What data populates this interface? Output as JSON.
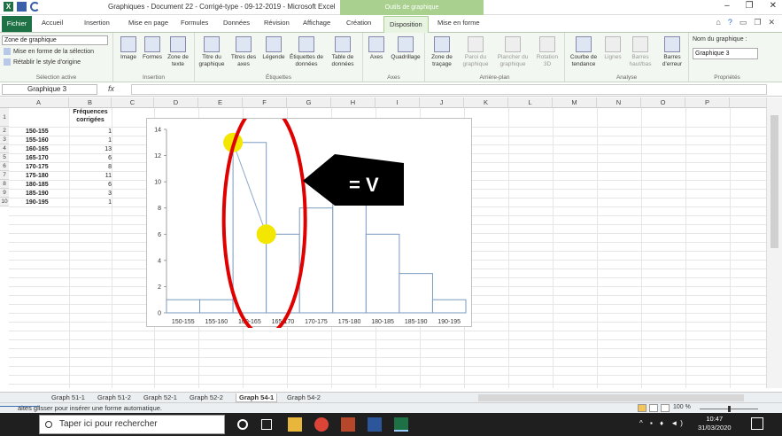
{
  "titlebar": {
    "doc_title": "Graphiques - Document 22 - Corrigé-type - 09-12-2019 - Microsoft Excel",
    "ctx_group": "Outils de graphique"
  },
  "tabs": {
    "file": "Fichier",
    "home": "Accueil",
    "insert": "Insertion",
    "page_layout": "Mise en page",
    "formulas": "Formules",
    "data": "Données",
    "review": "Révision",
    "view": "Affichage",
    "design": "Création",
    "layout": "Disposition",
    "format": "Mise en forme"
  },
  "ribbon": {
    "selection_combo": "Zone de graphique",
    "format_selection": "Mise en forme de la sélection",
    "reset_style": "Rétablir le style d'origine",
    "group_selection": "Sélection active",
    "image": "Image",
    "shapes": "Formes",
    "textbox": "Zone de texte",
    "group_insert": "Insertion",
    "chart_title": "Titre du graphique",
    "axis_titles": "Titres des axes",
    "legend": "Légende",
    "data_labels": "Étiquettes de données",
    "data_table": "Table de données",
    "group_labels": "Étiquettes",
    "axes": "Axes",
    "gridlines": "Quadrillage",
    "group_axes": "Axes",
    "plot_area": "Zone de traçage",
    "chart_wall": "Paroi du graphique",
    "chart_floor": "Plancher du graphique",
    "rotation": "Rotation 3D",
    "group_background": "Arrière-plan",
    "trendline": "Courbe de tendance",
    "lines": "Lignes",
    "updown_bars": "Barres haut/bas",
    "error_bars": "Barres d'erreur",
    "group_analysis": "Analyse",
    "chart_name_label": "Nom du graphique :",
    "chart_name_value": "Graphique 3",
    "group_properties": "Propriétés"
  },
  "formula_bar": {
    "name_box": "Graphique 3",
    "fx": "fx"
  },
  "columns": [
    "A",
    "B",
    "C",
    "D",
    "E",
    "F",
    "G",
    "H",
    "I",
    "J",
    "K",
    "L",
    "M",
    "N",
    "O",
    "P"
  ],
  "rows": [
    "1",
    "2",
    "3",
    "4",
    "5",
    "6",
    "7",
    "8",
    "9",
    "10"
  ],
  "sheet": {
    "header_b_line1": "Fréquences",
    "header_b_line2": "corrigées",
    "data": [
      {
        "label": "150-155",
        "value": "1"
      },
      {
        "label": "155-160",
        "value": "1"
      },
      {
        "label": "160-165",
        "value": "13"
      },
      {
        "label": "165-170",
        "value": "6"
      },
      {
        "label": "170-175",
        "value": "8"
      },
      {
        "label": "175-180",
        "value": "11"
      },
      {
        "label": "180-185",
        "value": "6"
      },
      {
        "label": "185-190",
        "value": "3"
      },
      {
        "label": "190-195",
        "value": "1"
      }
    ]
  },
  "chart_data": {
    "type": "bar",
    "categories": [
      "150-155",
      "155-160",
      "160-165",
      "165-170",
      "170-175",
      "175-180",
      "180-185",
      "185-190",
      "190-195"
    ],
    "values": [
      1,
      1,
      13,
      6,
      8,
      11,
      6,
      3,
      1
    ],
    "ylim": [
      0,
      14
    ],
    "yticks": [
      "0",
      "2",
      "4",
      "6",
      "8",
      "10",
      "12",
      "14"
    ],
    "grid": false,
    "bar_stroke": "#7a9ac0",
    "annotation_text": "= V",
    "annotation_ellipse_color": "#e00000",
    "marker_color": "#f3e600",
    "markers": [
      {
        "category": "160-165",
        "value": 13
      },
      {
        "category": "165-170",
        "value": 6
      }
    ]
  },
  "sheet_tabs": [
    "Graph 51-1",
    "Graph 51-2",
    "Graph 52-1",
    "Graph 52-2",
    "Graph 54-1",
    "Graph 54-2"
  ],
  "active_sheet": "Graph 54-1",
  "status": {
    "message": "aites glisser pour insérer une forme automatique.",
    "zoom": "100 %"
  },
  "taskbar": {
    "search_placeholder": "Taper ici pour rechercher",
    "time": "10:47",
    "date": "31/03/2020"
  }
}
